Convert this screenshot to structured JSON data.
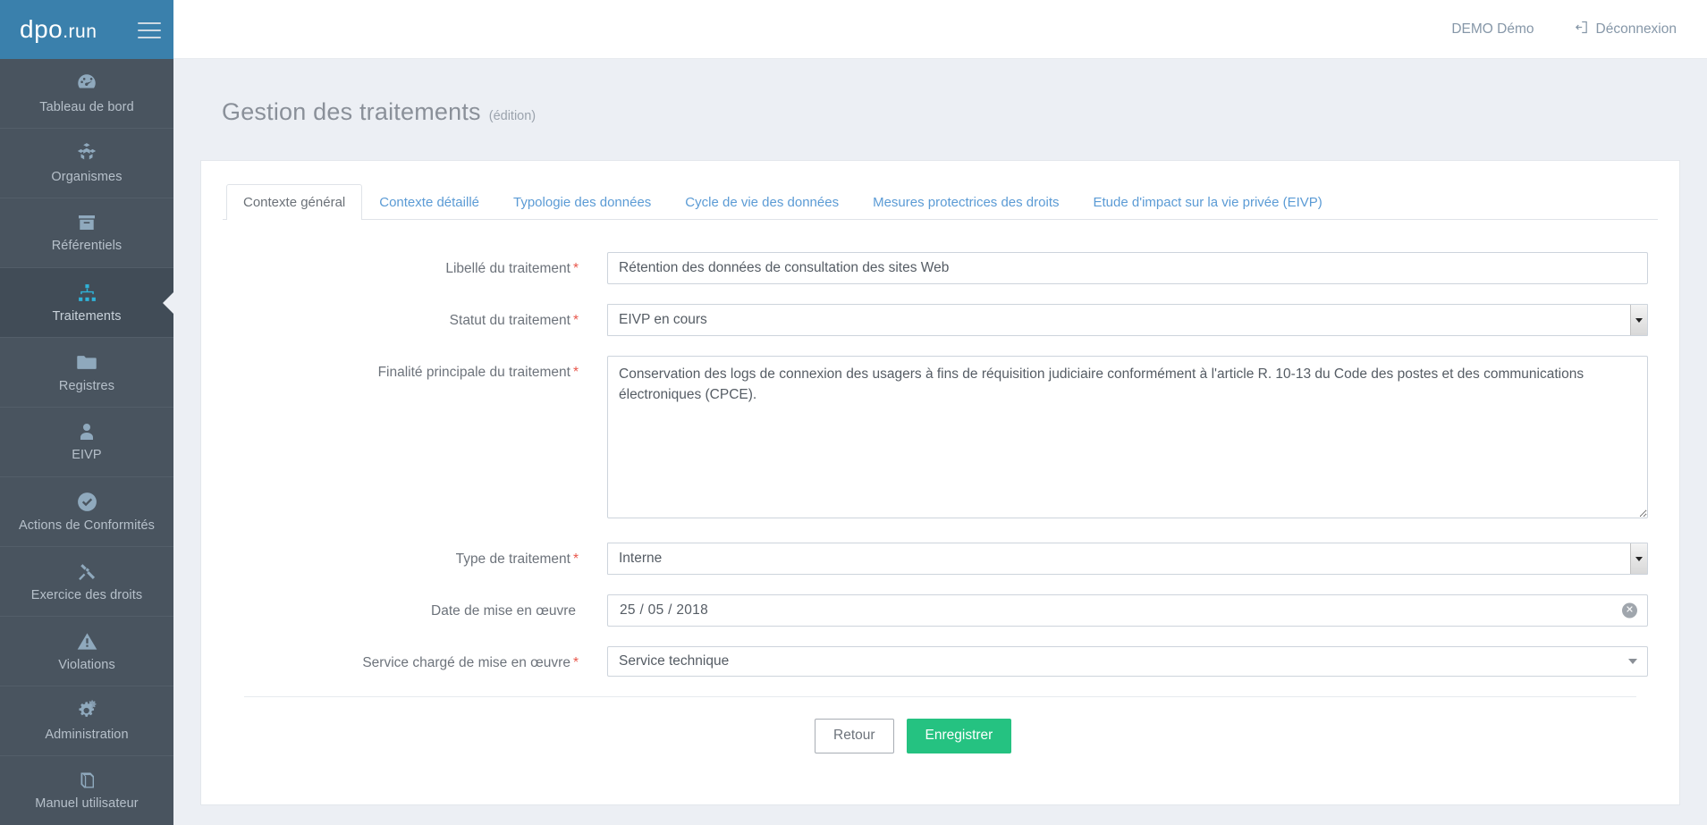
{
  "brand": {
    "name": "dpo",
    "suffix": ".run",
    "menu_icon": "hamburger-icon"
  },
  "topbar": {
    "user": "DEMO Démo",
    "logout_label": "Déconnexion",
    "logout_icon": "sign-out-icon"
  },
  "sidebar": {
    "items": [
      {
        "label": "Tableau de bord",
        "icon": "dashboard-icon",
        "active": false
      },
      {
        "label": "Organismes",
        "icon": "cubes-icon",
        "active": false
      },
      {
        "label": "Référentiels",
        "icon": "archive-box-icon",
        "active": false
      },
      {
        "label": "Traitements",
        "icon": "sitemap-icon",
        "active": true
      },
      {
        "label": "Registres",
        "icon": "folder-icon",
        "active": false
      },
      {
        "label": "EIVP",
        "icon": "user-icon",
        "active": false
      },
      {
        "label": "Actions de Conformités",
        "icon": "check-circle-icon",
        "active": false
      },
      {
        "label": "Exercice des droits",
        "icon": "gavel-icon",
        "active": false
      },
      {
        "label": "Violations",
        "icon": "warning-triangle-icon",
        "active": false
      },
      {
        "label": "Administration",
        "icon": "gears-icon",
        "active": false
      },
      {
        "label": "Manuel utilisateur",
        "icon": "book-icon",
        "active": false
      }
    ]
  },
  "page": {
    "title": "Gestion des traitements",
    "subtitle": "(édition)"
  },
  "tabs": [
    {
      "label": "Contexte général",
      "active": true
    },
    {
      "label": "Contexte détaillé",
      "active": false
    },
    {
      "label": "Typologie des données",
      "active": false
    },
    {
      "label": "Cycle de vie des données",
      "active": false
    },
    {
      "label": "Mesures protectrices des droits",
      "active": false
    },
    {
      "label": "Etude d'impact sur la vie privée (EIVP)",
      "active": false
    }
  ],
  "form": {
    "libelle": {
      "label": "Libellé du traitement",
      "required": "*",
      "value": "Rétention des données de consultation des sites Web",
      "placeholder": ""
    },
    "statut": {
      "label": "Statut du traitement",
      "required": "*",
      "value": "EIVP en cours"
    },
    "finalite": {
      "label": "Finalité principale du traitement",
      "required": "*",
      "value": "Conservation des logs de connexion des usagers à fins de réquisition judiciaire conformément à l'article R. 10-13 du Code des postes et des communications électroniques (CPCE).",
      "placeholder": ""
    },
    "type": {
      "label": "Type de traitement",
      "required": "*",
      "value": "Interne"
    },
    "date_mise_en_oeuvre": {
      "label": "Date de mise en œuvre",
      "required": "",
      "value": "25 / 05 / 2018",
      "clear_icon": "clear-circle-icon"
    },
    "service": {
      "label": "Service chargé de mise en œuvre",
      "required": "*",
      "value": "Service technique"
    }
  },
  "actions": {
    "back_label": "Retour",
    "save_label": "Enregistrer"
  },
  "colors": {
    "brand_blue": "#3a80ac",
    "sidebar_bg": "#49545f",
    "sidebar_active_bg": "#414c57",
    "accent_cyan": "#2fb3d9",
    "link_blue": "#5b9bd5",
    "success_green": "#25c281",
    "required_red": "#e8574c",
    "page_bg": "#eceff4"
  }
}
